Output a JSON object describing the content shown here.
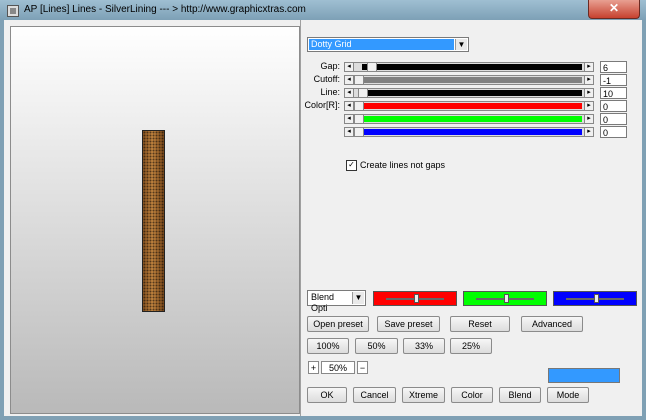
{
  "window": {
    "title": "AP [Lines]  Lines - SilverLining    --- > http://www.graphicxtras.com",
    "close_label": "✕"
  },
  "effect_dropdown": {
    "selected": "Dotty Grid",
    "arrow": "▼"
  },
  "sliders": [
    {
      "label": "Gap:",
      "value": "6",
      "level": 0.06,
      "color": "#000000"
    },
    {
      "label": "Cutoff:",
      "value": "-1",
      "level": 0.0,
      "color": "#808080"
    },
    {
      "label": "Line:",
      "value": "10",
      "level": 0.02,
      "color": "#000000"
    },
    {
      "label": "Color[R]:",
      "value": "0",
      "level": 0.0,
      "color": "#ff0000"
    },
    {
      "label": "",
      "value": "0",
      "level": 0.0,
      "color": "#00ff00"
    },
    {
      "label": "",
      "value": "0",
      "level": 0.0,
      "color": "#0000ff"
    }
  ],
  "checkbox": {
    "label": "Create lines not gaps",
    "mark": "✓"
  },
  "blend_dropdown": {
    "selected": "Blend Opti",
    "arrow": "▼"
  },
  "blend_swatches": [
    {
      "color": "#ff0000",
      "level": 0.5
    },
    {
      "color": "#00ff00",
      "level": 0.5
    },
    {
      "color": "#0000ff",
      "level": 0.5
    }
  ],
  "buttons": {
    "open_preset": "Open preset",
    "save_preset": "Save preset",
    "reset": "Reset",
    "advanced": "Advanced",
    "zoom_100": "100%",
    "zoom_50": "50%",
    "zoom_33": "33%",
    "zoom_25": "25%",
    "ok": "OK",
    "cancel": "Cancel",
    "xtreme": "Xtreme",
    "color": "Color",
    "blend": "Blend",
    "mode": "Mode"
  },
  "zoom": {
    "plus": "+",
    "value": "50%",
    "minus": "−"
  },
  "color_bar": "#3399ff"
}
